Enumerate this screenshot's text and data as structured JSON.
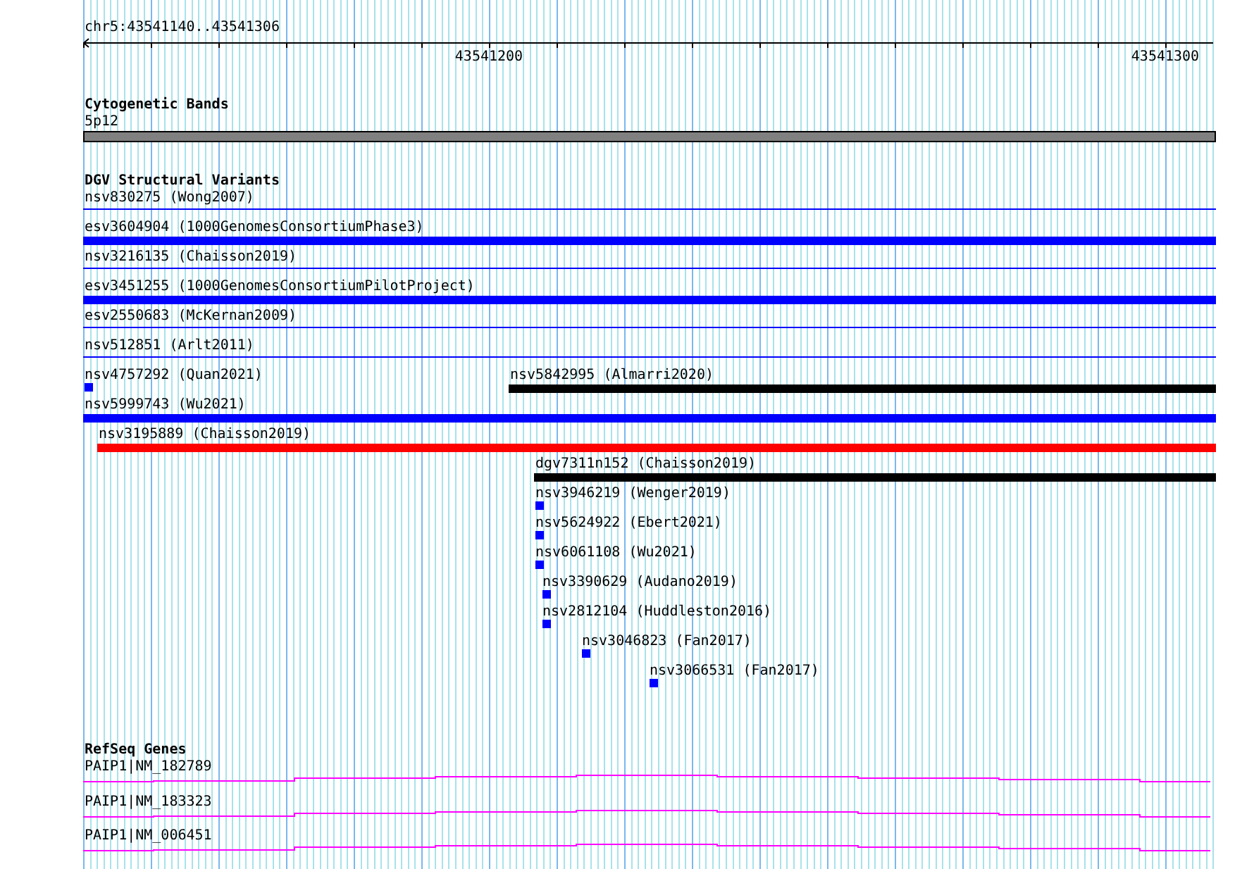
{
  "ruler": {
    "range": "chr5:43541140..43541306",
    "ticks": [
      "43541200",
      "43541300"
    ]
  },
  "tracks": [
    {
      "kind": "cytoband",
      "title": "Cytogenetic Bands",
      "band": "5p12"
    },
    {
      "kind": "variants",
      "title": "DGV Structural Variants",
      "rows": [
        {
          "features": [
            {
              "label": "nsv830275 (Wong2007)",
              "kind": "line",
              "color": "#0000ff"
            }
          ]
        },
        {
          "features": [
            {
              "label": "esv3604904 (1000GenomesConsortiumPhase3)",
              "kind": "bar",
              "color": "#0000ff"
            }
          ]
        },
        {
          "features": [
            {
              "label": "nsv3216135 (Chaisson2019)",
              "kind": "line",
              "color": "#0000ff"
            }
          ]
        },
        {
          "features": [
            {
              "label": "esv3451255 (1000GenomesConsortiumPilotProject)",
              "kind": "bar",
              "color": "#0000ff"
            }
          ]
        },
        {
          "features": [
            {
              "label": "esv2550683 (McKernan2009)",
              "kind": "line",
              "color": "#0000ff"
            }
          ]
        },
        {
          "features": [
            {
              "label": "nsv512851 (Arlt2011)",
              "kind": "line",
              "color": "#0000ff"
            }
          ]
        },
        {
          "features": [
            {
              "label": "nsv4757292 (Quan2021)",
              "kind": "point",
              "color": "#0000ff"
            },
            {
              "label": "nsv5842995 (Almarri2020)",
              "kind": "bar",
              "color": "#000000"
            }
          ]
        },
        {
          "features": [
            {
              "label": "nsv5999743 (Wu2021)",
              "kind": "bar",
              "color": "#0000ff"
            }
          ]
        },
        {
          "features": [
            {
              "label": "nsv3195889 (Chaisson2019)",
              "kind": "bar",
              "color": "#ff0000"
            }
          ]
        },
        {
          "features": [
            {
              "label": "dgv7311n152 (Chaisson2019)",
              "kind": "bar",
              "color": "#000000"
            }
          ]
        },
        {
          "features": [
            {
              "label": "nsv3946219 (Wenger2019)",
              "kind": "point",
              "color": "#0000ff"
            }
          ]
        },
        {
          "features": [
            {
              "label": "nsv5624922 (Ebert2021)",
              "kind": "point",
              "color": "#0000ff"
            }
          ]
        },
        {
          "features": [
            {
              "label": "nsv6061108 (Wu2021)",
              "kind": "point",
              "color": "#0000ff"
            }
          ]
        },
        {
          "features": [
            {
              "label": "nsv3390629 (Audano2019)",
              "kind": "point",
              "color": "#0000ff"
            }
          ]
        },
        {
          "features": [
            {
              "label": "nsv2812104 (Huddleston2016)",
              "kind": "point",
              "color": "#0000ff"
            }
          ]
        },
        {
          "features": [
            {
              "label": "nsv3046823 (Fan2017)",
              "kind": "point",
              "color": "#0000ff"
            }
          ]
        },
        {
          "features": [
            {
              "label": "nsv3066531 (Fan2017)",
              "kind": "point",
              "color": "#0000ff"
            }
          ]
        }
      ]
    },
    {
      "kind": "genes",
      "title": "RefSeq Genes",
      "genes": [
        "PAIP1|NM_182789",
        "PAIP1|NM_183323",
        "PAIP1|NM_006451"
      ]
    }
  ]
}
